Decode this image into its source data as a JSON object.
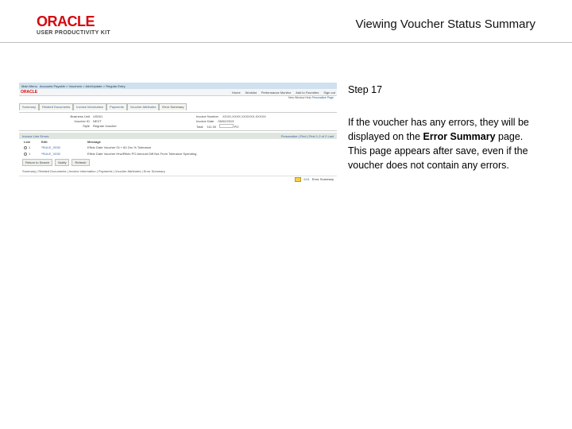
{
  "header": {
    "brand_main": "ORACLE",
    "brand_sub": "USER PRODUCTIVITY KIT",
    "title": "Viewing Voucher Status Summary"
  },
  "instruction": {
    "step_label": "Step 17",
    "body_pre": "If the voucher has any errors, they will be displayed on the ",
    "body_bold": "Error Summary",
    "body_post": " page. This page appears after save, even if the voucher does not contain any errors."
  },
  "mini": {
    "breadcrumb_left": "Main Menu",
    "breadcrumb_rest": "Accounts Payable > Vouchers > Add/Update > Regular Entry",
    "brand": "ORACLE",
    "menu": [
      "Home",
      "Worklist",
      "Performance Monitor",
      "Add to Favorites",
      "Sign out"
    ],
    "new_window": "New Window  Help  ",
    "personalize": "Personalize Page",
    "tabs": [
      "Summary",
      "Related Documents",
      "Invoice Information",
      "Payments",
      "Voucher Attributes",
      "Error Summary"
    ],
    "form": {
      "business_unit_k": "Business Unit",
      "business_unit_v": "US001",
      "voucher_id_k": "Voucher ID",
      "voucher_id_v": "NEXT",
      "style_k": "Style",
      "style_v": "Regular Voucher",
      "invoice_no_k": "Invoice Number",
      "invoice_no_v": "XXXX-XXXX-XXXXXX-XXXXX",
      "invoice_date_k": "Invoice Date",
      "invoice_date_v": "05/02/2013",
      "total_k": "Total",
      "total_v": "111.00",
      "extra_k": "",
      "extra_v": "",
      "po_k": "",
      "po_v": "PO"
    },
    "section_title": "Invoice Line Errors",
    "section_ctrl": "Personalize | Find |   First 1-2 of 2   Last",
    "row_headers": [
      "Line",
      "Edit",
      "Message"
    ],
    "rows": [
      {
        "line": "1",
        "id": "*RULE_V030",
        "msg": "Effctv Date Voucher Gt + 60 Grc % Tolerance"
      },
      {
        "line": "1",
        "id": "*RULE_V030",
        "msg": "Effctv Date Voucher Hrw/Effctv PO Amount Diff Not From Tolerance Spending"
      }
    ],
    "buttons": [
      "Return to Search",
      "Notify",
      "Refresh"
    ],
    "footnote": "Summary | Related Documents | Invoice Information | Payments | Voucher Attributes | Error Summary",
    "page_indicator": "6/11",
    "bottom_label": "Error Summary"
  }
}
